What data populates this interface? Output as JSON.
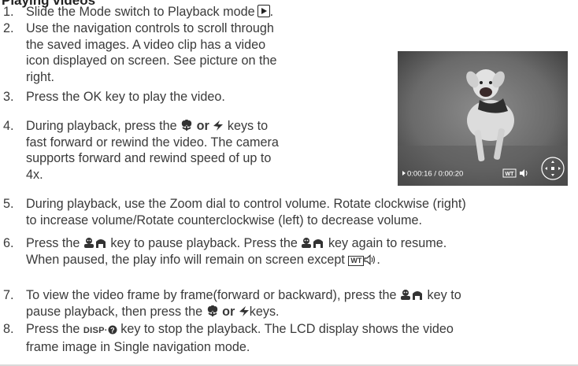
{
  "section_title": "Playing videos",
  "steps": [
    {
      "num": "1.",
      "lines": [
        "Slide the Mode switch to Playback mode"
      ]
    },
    {
      "num": "2.",
      "lines": [
        "Use the navigation controls to scroll through",
        "the saved images. A video clip has a video",
        "icon displayed on screen. See picture on the",
        "right."
      ]
    },
    {
      "num": "3.",
      "lines": [
        "Press the OK key to play the video."
      ]
    },
    {
      "num": "4.",
      "line1_a": "During playback, press the",
      "line1_b": "or",
      "line1_c": "keys to",
      "lines_rest": [
        "fast forward or rewind the video. The camera",
        "supports forward and rewind speed of up to",
        "4x."
      ]
    },
    {
      "num": "5.",
      "lines": [
        "During playback, use the Zoom dial to control volume. Rotate clockwise (right)",
        "to increase volume/Rotate counterclockwise (left) to decrease volume."
      ]
    },
    {
      "num": "6.",
      "line1_a": "Press the",
      "line1_b": "key to pause playback. Press the",
      "line1_c": "key again to resume.",
      "line2_a": "When paused, the play info will remain on screen except"
    },
    {
      "num": "7.",
      "line1_a": "To view the video frame by frame(forward or backward), press the",
      "line1_b": "key to",
      "line2_a": "pause playback, then press the",
      "line2_b": "or",
      "line2_c": "keys."
    },
    {
      "num": "8.",
      "line1_a": "Press the",
      "line1_b": "key to stop the playback. The LCD display shows the video",
      "line2_a": "frame image in Single navigation mode."
    }
  ],
  "icons": {
    "playback": "playback-mode-icon",
    "macro": "macro-flower-icon",
    "flash": "flash-icon",
    "face_scene": "face-scene-icon",
    "wt": "WT",
    "volume": "speaker-icon",
    "disp": "DISP·"
  },
  "photo": {
    "timecode": "0:00:16 / 0:00:20",
    "wt_badge": "WT"
  }
}
